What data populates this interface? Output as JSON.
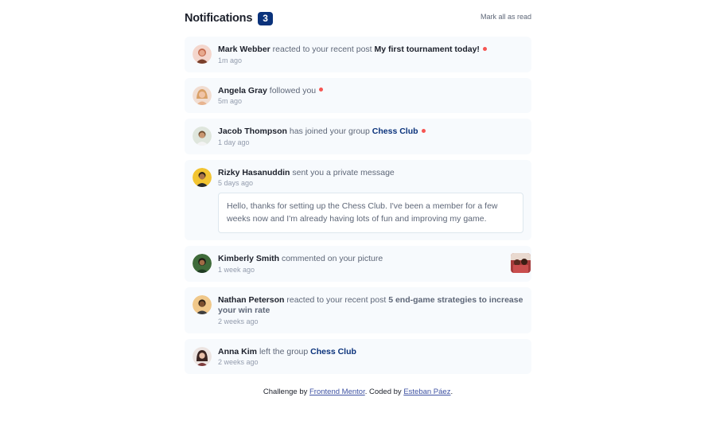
{
  "header": {
    "title": "Notifications",
    "count": "3",
    "mark_all": "Mark all as read"
  },
  "notifications": [
    {
      "name": "Mark Webber",
      "action": "reacted to your recent post",
      "target": "My first tournament today!",
      "time": "1m ago"
    },
    {
      "name": "Angela Gray",
      "action": "followed you",
      "time": "5m ago"
    },
    {
      "name": "Jacob Thompson",
      "action": "has joined your group",
      "target": "Chess Club",
      "time": "1 day ago"
    },
    {
      "name": "Rizky Hasanuddin",
      "action": "sent you a private message",
      "time": "5 days ago",
      "message": "Hello, thanks for setting up the Chess Club. I've been a member for a few weeks now and I'm already having lots of fun and improving my game."
    },
    {
      "name": "Kimberly Smith",
      "action": "commented on your picture",
      "time": "1 week ago"
    },
    {
      "name": "Nathan Peterson",
      "action": "reacted to your recent post",
      "target": "5 end-game strategies to increase your win rate",
      "time": "2 weeks ago"
    },
    {
      "name": "Anna Kim",
      "action": "left the group",
      "target": "Chess Club",
      "time": "2 weeks ago"
    }
  ],
  "footer": {
    "prefix": "Challenge by",
    "link1": "Frontend Mentor",
    "middle": ". Coded by",
    "link2": "Esteban Páez",
    "suffix": "."
  },
  "colors": {
    "accent": "#0a327b",
    "unread_dot": "#f65552",
    "card_bg": "#f7fafd",
    "muted": "#5e6778",
    "time": "#939cad"
  },
  "icons": {
    "avatar": "avatar-photo",
    "picture": "picture-thumbnail"
  }
}
